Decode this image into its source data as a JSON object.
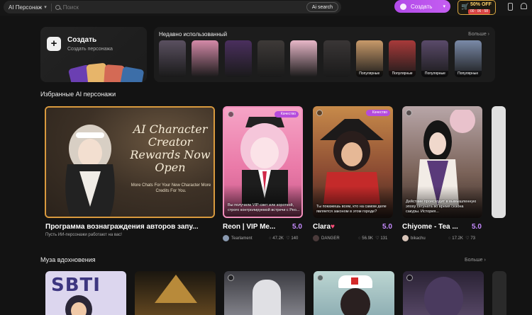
{
  "header": {
    "scope_label": "AI Персонаж",
    "search_placeholder": "Поиск",
    "ai_search_label": "Ai search",
    "create_label": "Создать",
    "promo_discount": "50% OFF",
    "promo_timer": "00 : 06 : 58"
  },
  "create_panel": {
    "title": "Создать",
    "subtitle": "Создать персонажа"
  },
  "recent": {
    "title": "Недавно использованный",
    "more_label": "Больше",
    "popular_label": "Популярные",
    "thumbs": [
      {
        "name": "recent-thumb-1",
        "popular": false,
        "color": "#5a5060"
      },
      {
        "name": "recent-thumb-2",
        "popular": false,
        "color": "#d48aa8"
      },
      {
        "name": "recent-thumb-3",
        "popular": false,
        "color": "#4a2f5e"
      },
      {
        "name": "recent-thumb-4",
        "popular": false,
        "color": "#3e3a38"
      },
      {
        "name": "recent-thumb-5",
        "popular": false,
        "color": "#e8b7c8"
      },
      {
        "name": "recent-thumb-6",
        "popular": false,
        "color": "#3a3636"
      },
      {
        "name": "recent-thumb-7",
        "popular": true,
        "color": "#c89a6a"
      },
      {
        "name": "recent-thumb-8",
        "popular": true,
        "color": "#a83a3a"
      },
      {
        "name": "recent-thumb-9",
        "popular": true,
        "color": "#5a4a6a"
      },
      {
        "name": "recent-thumb-10",
        "popular": true,
        "color": "#7a8aa8"
      }
    ]
  },
  "featured": {
    "section_title": "Избранные AI персонажи",
    "banner": {
      "headline": "AI Character Creator Rewards Now Open",
      "subline": "More Chats For Your New Character More Credits For You.",
      "title": "Программа вознаграждения авторов запу...",
      "subtitle": "Пусть ИИ-персонажи работают на вас!"
    },
    "badge_label": "Качество",
    "characters": [
      {
        "name": "Reon | VIP Me...",
        "rating": "5.0",
        "author": "Tearlament",
        "chats": "47.2K",
        "likes": "140",
        "quality": true,
        "desc": "Вы получили VIP-свет или короткой, строго контролируемой встречи с Рео..."
      },
      {
        "name": "Clara",
        "heart": "♥",
        "rating": "5.0",
        "author": "DANGER",
        "chats": "56.9K",
        "likes": "131",
        "quality": true,
        "desc": "Ты покажешь всем, кто на самом деле является законом в этом городе?"
      },
      {
        "name": "Chiyome - Tea ...",
        "rating": "5.0",
        "author": "bikachu",
        "chats": "17.2K",
        "likes": "73",
        "quality": false,
        "desc": "Действие происходит в вымышленную эпоху сёгуната во время сезона сакуры. История..."
      }
    ]
  },
  "inspiration": {
    "section_title": "Муза вдохновения",
    "more_label": "Больше",
    "first_card_text": "SBTI"
  }
}
